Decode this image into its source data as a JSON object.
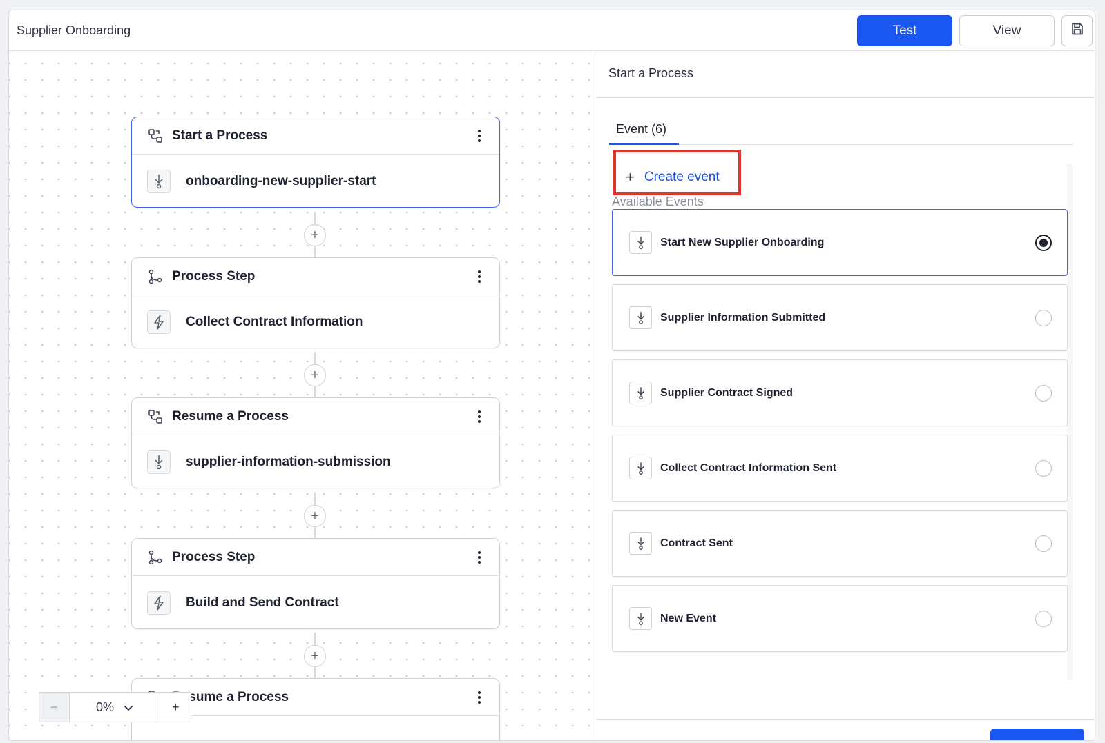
{
  "header": {
    "title": "Supplier Onboarding",
    "test_label": "Test",
    "view_label": "View",
    "save_icon": "save-icon",
    "accent_color": "#1a56f0"
  },
  "flow": {
    "cards": [
      {
        "type_icon": "process-start-icon",
        "title": "Start a Process",
        "body_icon": "event-arrow-icon",
        "body": "onboarding-new-supplier-start",
        "selected": true
      },
      {
        "type_icon": "process-step-icon",
        "title": "Process Step",
        "body_icon": "lightning-icon",
        "body": "Collect Contract Information",
        "selected": false
      },
      {
        "type_icon": "process-start-icon",
        "title": "Resume a Process",
        "body_icon": "event-arrow-icon",
        "body": "supplier-information-submission",
        "selected": false
      },
      {
        "type_icon": "process-step-icon",
        "title": "Process Step",
        "body_icon": "lightning-icon",
        "body": "Build and Send Contract",
        "selected": false
      },
      {
        "type_icon": "process-start-icon",
        "title": "Resume a Process",
        "body_icon": "event-arrow-icon",
        "body": "",
        "selected": false
      }
    ],
    "add_node_symbol": "+"
  },
  "zoom": {
    "minus": "−",
    "value": "0%",
    "plus": "+"
  },
  "panel": {
    "title": "Start a Process",
    "tab_label": "Event (6)",
    "create_event_plus": "+",
    "create_event_label": "Create event",
    "highlight_color": "#e8332a",
    "available_label": "Available Events",
    "events": [
      {
        "label": "Start New Supplier Onboarding",
        "selected": true
      },
      {
        "label": "Supplier Information Submitted",
        "selected": false
      },
      {
        "label": "Supplier Contract Signed",
        "selected": false
      },
      {
        "label": "Collect Contract Information Sent",
        "selected": false
      },
      {
        "label": "Contract Sent",
        "selected": false
      },
      {
        "label": "New Event",
        "selected": false
      }
    ]
  }
}
